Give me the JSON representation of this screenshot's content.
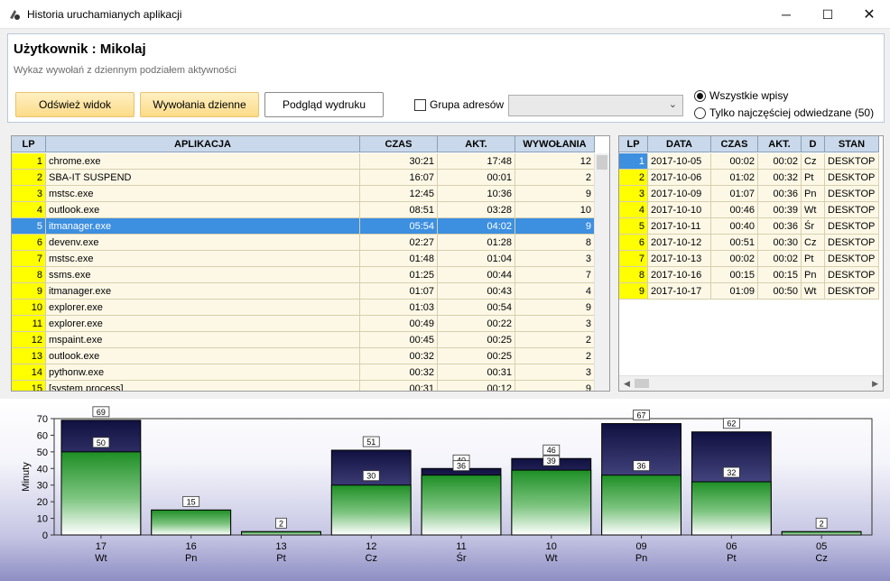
{
  "window": {
    "title": "Historia uruchamianych aplikacji",
    "minimize_glyph": "─",
    "maximize_glyph": "☐",
    "close_glyph": "✕",
    "icon": "app-icon"
  },
  "header": {
    "user_title": "Użytkownik : Mikolaj",
    "subtitle": "Wykaz wywołań z dziennym podziałem aktywności",
    "refresh_label": "Odśwież widok",
    "daily_label": "Wywołania dzienne",
    "preview_label": "Podgląd wydruku",
    "group_label": "Grupa adresów",
    "group_checked": false,
    "group_select_value": "",
    "radio_all_label": "Wszystkie wpisy",
    "radio_top_label": "Tylko najczęściej odwiedzane (50)",
    "radio_selected": "all"
  },
  "apps_table": {
    "columns": [
      "LP",
      "APLIKACJA",
      "CZAS",
      "AKT.",
      "WYWOŁANIA"
    ],
    "selected_index": 4,
    "rows": [
      [
        "1",
        "chrome.exe",
        "30:21",
        "17:48",
        "12"
      ],
      [
        "2",
        "SBA-IT SUSPEND",
        "16:07",
        "00:01",
        "2"
      ],
      [
        "3",
        "mstsc.exe",
        "12:45",
        "10:36",
        "9"
      ],
      [
        "4",
        "outlook.exe",
        "08:51",
        "03:28",
        "10"
      ],
      [
        "5",
        "itmanager.exe",
        "05:54",
        "04:02",
        "9"
      ],
      [
        "6",
        "devenv.exe",
        "02:27",
        "01:28",
        "8"
      ],
      [
        "7",
        "mstsc.exe",
        "01:48",
        "01:04",
        "3"
      ],
      [
        "8",
        "ssms.exe",
        "01:25",
        "00:44",
        "7"
      ],
      [
        "9",
        "itmanager.exe",
        "01:07",
        "00:43",
        "4"
      ],
      [
        "10",
        "explorer.exe",
        "01:03",
        "00:54",
        "9"
      ],
      [
        "11",
        "explorer.exe",
        "00:49",
        "00:22",
        "3"
      ],
      [
        "12",
        "mspaint.exe",
        "00:45",
        "00:25",
        "2"
      ],
      [
        "13",
        "outlook.exe",
        "00:32",
        "00:25",
        "2"
      ],
      [
        "14",
        "pythonw.exe",
        "00:32",
        "00:31",
        "3"
      ],
      [
        "15",
        "[system process]",
        "00:31",
        "00:12",
        "9"
      ]
    ]
  },
  "days_table": {
    "columns": [
      "LP",
      "DATA",
      "CZAS",
      "AKT.",
      "D",
      "STAN"
    ],
    "selected_index": 0,
    "rows": [
      [
        "1",
        "2017-10-05",
        "00:02",
        "00:02",
        "Cz",
        "DESKTOP"
      ],
      [
        "2",
        "2017-10-06",
        "01:02",
        "00:32",
        "Pt",
        "DESKTOP"
      ],
      [
        "3",
        "2017-10-09",
        "01:07",
        "00:36",
        "Pn",
        "DESKTOP"
      ],
      [
        "4",
        "2017-10-10",
        "00:46",
        "00:39",
        "Wt",
        "DESKTOP"
      ],
      [
        "5",
        "2017-10-11",
        "00:40",
        "00:36",
        "Śr",
        "DESKTOP"
      ],
      [
        "6",
        "2017-10-12",
        "00:51",
        "00:30",
        "Cz",
        "DESKTOP"
      ],
      [
        "7",
        "2017-10-13",
        "00:02",
        "00:02",
        "Pt",
        "DESKTOP"
      ],
      [
        "8",
        "2017-10-16",
        "00:15",
        "00:15",
        "Pn",
        "DESKTOP"
      ],
      [
        "9",
        "2017-10-17",
        "01:09",
        "00:50",
        "Wt",
        "DESKTOP"
      ]
    ]
  },
  "chart_data": {
    "type": "bar",
    "ylabel": "Minuty",
    "ylim": [
      0,
      70
    ],
    "yticks": [
      0,
      10,
      20,
      30,
      40,
      50,
      60,
      70
    ],
    "grid": false,
    "categories": [
      "17",
      "16",
      "13",
      "12",
      "11",
      "10",
      "09",
      "06",
      "05"
    ],
    "category_days": [
      "Wt",
      "Pn",
      "Pt",
      "Cz",
      "Śr",
      "Wt",
      "Pn",
      "Pt",
      "Cz"
    ],
    "series": [
      {
        "values": [
          69,
          15,
          2,
          51,
          40,
          46,
          67,
          62,
          2
        ],
        "color": "#101040"
      },
      {
        "values": [
          50,
          15,
          2,
          30,
          36,
          39,
          36,
          32,
          2
        ],
        "color": "#1e8f25"
      }
    ]
  }
}
